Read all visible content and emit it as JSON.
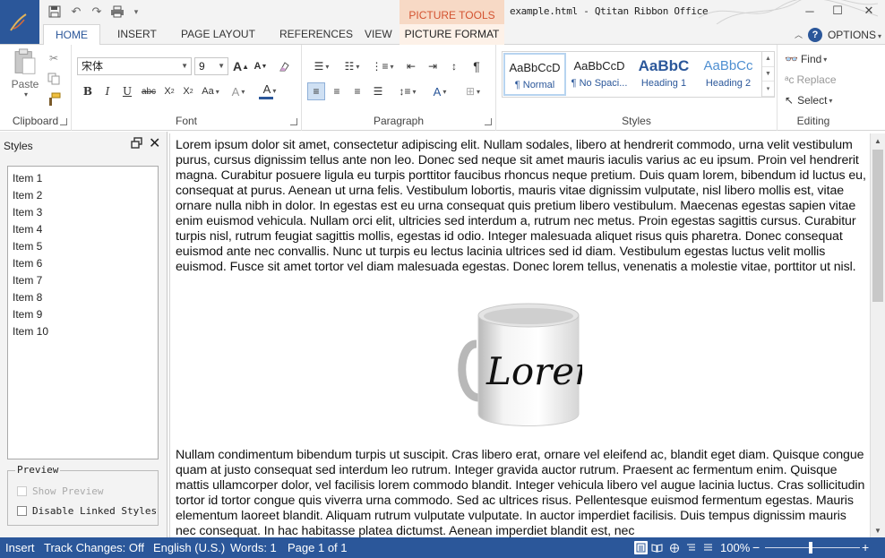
{
  "titlebar": {
    "window_title": "example.html - Qtitan Ribbon Office",
    "context_group": "PICTURE TOOLS",
    "qat": [
      "save-icon",
      "undo-icon",
      "redo-icon",
      "print-icon",
      "customize-icon"
    ],
    "controls": [
      "minimize-icon",
      "maximize-icon",
      "close-icon"
    ]
  },
  "tabs": [
    {
      "label": "HOME",
      "active": true
    },
    {
      "label": "INSERT"
    },
    {
      "label": "PAGE LAYOUT"
    },
    {
      "label": "REFERENCES"
    },
    {
      "label": "VIEW"
    },
    {
      "label": "PICTURE FORMAT",
      "context": true
    }
  ],
  "options_label": "OPTIONS",
  "ribbon": {
    "clipboard": {
      "label": "Clipboard",
      "paste": "Paste"
    },
    "font": {
      "label": "Font",
      "font_name": "宋体",
      "font_size": "9"
    },
    "paragraph": {
      "label": "Paragraph"
    },
    "styles": {
      "label": "Styles",
      "items": [
        {
          "sample": "AaBbCcD",
          "name": "¶ Normal",
          "color": "#222222"
        },
        {
          "sample": "AaBbCcD",
          "name": "¶ No Spaci...",
          "color": "#222222"
        },
        {
          "sample": "AaBbC",
          "name": "Heading 1",
          "color": "#2b579a"
        },
        {
          "sample": "AaBbCc",
          "name": "Heading 2",
          "color": "#4e8fd1"
        }
      ]
    },
    "editing": {
      "label": "Editing",
      "find": "Find",
      "replace": "Replace",
      "select": "Select"
    }
  },
  "styles_pane": {
    "title": "Styles",
    "items": [
      "Item 1",
      "Item 2",
      "Item 3",
      "Item 4",
      "Item 5",
      "Item 6",
      "Item 7",
      "Item 8",
      "Item 9",
      "Item 10"
    ],
    "preview_group": "Preview",
    "show_preview": "Show Preview",
    "disable_linked": "Disable Linked Styles"
  },
  "document": {
    "para1": "Lorem ipsum dolor sit amet, consectetur adipiscing elit. Nullam sodales, libero at hendrerit commodo, urna velit vestibulum purus, cursus dignissim tellus ante non leo. Donec sed neque sit amet mauris iaculis varius ac eu ipsum. Proin vel hendrerit magna. Curabitur posuere ligula eu turpis porttitor faucibus rhoncus neque pretium. Duis quam lorem, bibendum id luctus eu, consequat at purus. Aenean ut urna felis. Vestibulum lobortis, mauris vitae dignissim vulputate, nisl libero mollis est, vitae ornare nulla nibh in dolor. In egestas est eu urna consequat quis pretium libero vestibulum. Maecenas egestas sapien vitae enim euismod vehicula. Nullam orci elit, ultricies sed interdum a, rutrum nec metus. Proin egestas sagittis cursus. Curabitur turpis nisl, rutrum feugiat sagittis mollis, egestas id odio. Integer malesuada aliquet risus quis pharetra. Donec consequat euismod ante nec convallis. Nunc ut turpis eu lectus lacinia ultrices sed id diam. Vestibulum egestas luctus velit mollis euismod. Fusce sit amet tortor vel diam malesuada egestas. Donec lorem tellus, venenatis a molestie vitae, porttitor ut nisl.",
    "mug_text": "Lorem",
    "para2": "Nullam condimentum bibendum turpis ut suscipit. Cras libero erat, ornare vel eleifend ac, blandit eget diam. Quisque congue quam at justo consequat sed interdum leo rutrum. Integer gravida auctor rutrum. Praesent ac fermentum enim. Quisque mattis ullamcorper dolor, vel facilisis lorem commodo blandit. Integer vehicula libero vel augue lacinia luctus. Cras sollicitudin tortor id tortor congue quis viverra urna commodo. Sed ac ultrices risus. Pellentesque euismod fermentum egestas. Mauris elementum laoreet blandit. Aliquam rutrum vulputate vulputate. In auctor imperdiet facilisis. Duis tempus dignissim mauris nec consequat. In hac habitasse platea dictumst. Aenean imperdiet blandit est, nec"
  },
  "statusbar": {
    "mode": "Insert",
    "track_changes": "Track Changes: Off",
    "language": "English (U.S.)",
    "words": "Words: 1",
    "page": "Page 1 of 1",
    "zoom": "100%",
    "zoom_level_percent": 100
  },
  "colors": {
    "accent": "#2b579a",
    "context_tab": "#d35230",
    "statusbar": "#2b579a"
  }
}
